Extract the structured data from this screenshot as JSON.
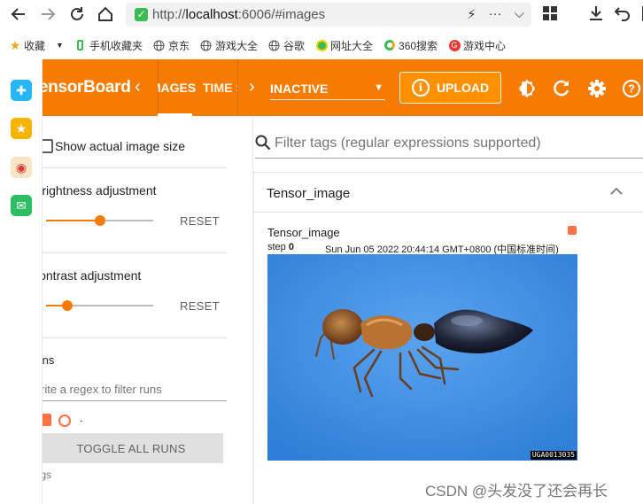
{
  "browser": {
    "url_prefix": "http://",
    "url_host": "localhost",
    "url_rest": ":6006/#images",
    "bookmarks": [
      {
        "label": "收藏",
        "icon": "star-icon"
      },
      {
        "label": "手机收藏夹",
        "icon": "phone-icon"
      },
      {
        "label": "京东",
        "icon": "globe-icon"
      },
      {
        "label": "游戏大全",
        "icon": "globe-icon"
      },
      {
        "label": "谷歌",
        "icon": "globe-icon"
      },
      {
        "label": "网址大全",
        "icon": "url-nav-icon"
      },
      {
        "label": "360搜索",
        "icon": "search-360-icon"
      },
      {
        "label": "游戏中心",
        "icon": "game-center-icon"
      }
    ]
  },
  "toolbar": {
    "title": "TensorBoard",
    "tabs": [
      "IMAGES",
      "TIME SERIES"
    ],
    "inactive_label": "INACTIVE",
    "upload_label": "UPLOAD"
  },
  "panel": {
    "show_actual_size": "Show actual image size",
    "brightness_label": "Brightness adjustment",
    "contrast_label": "Contrast adjustment",
    "reset_label": "RESET",
    "brightness_value": 0.5,
    "contrast_value": 0.2,
    "runs_label": "Runs",
    "regex_placeholder": "Write a regex to filter runs",
    "run_name": ".",
    "toggle_label": "TOGGLE ALL RUNS",
    "logs_label": "logs"
  },
  "main": {
    "filter_placeholder": "Filter tags (regular expressions supported)",
    "card_title": "Tensor_image",
    "image_title": "Tensor_image",
    "step_label": "step",
    "step_value": "0",
    "timestamp": "Sun Jun 05 2022 20:44:14 GMT+0800 (中国标准时间)",
    "image_tag": "UGA0013035"
  },
  "watermark": "CSDN @头发没了还会再长",
  "colors": {
    "accent": "#f57c00",
    "run_color": "#ff7043",
    "image_bg": "#3f8fe3"
  }
}
